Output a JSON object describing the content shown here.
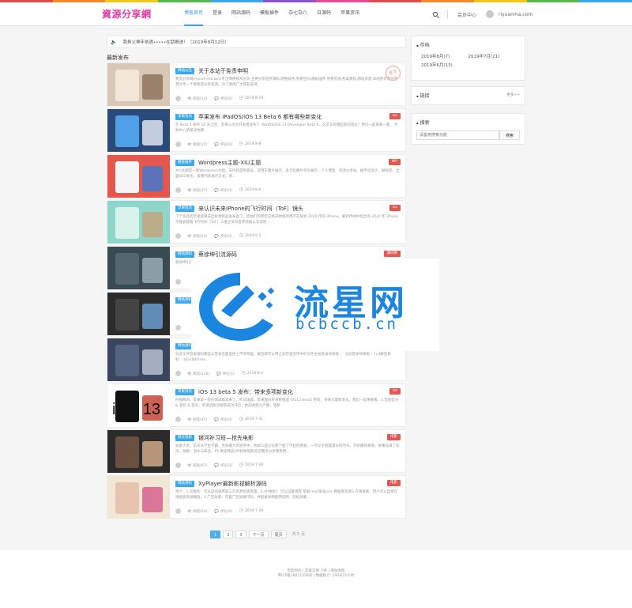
{
  "site": {
    "logo": "資源分享網",
    "logo_color": "#e03aa5",
    "accent": "#3a9df0"
  },
  "stripe_colors": [
    "#e24b4b",
    "#f08c2c",
    "#f2c81d",
    "#58b84d",
    "#39a8e8",
    "#8a56d0",
    "#e24b9a",
    "#e24b4b",
    "#f08c2c",
    "#f2c81d",
    "#58b84d",
    "#39a8e8"
  ],
  "nav": [
    "博客首页",
    "登录",
    "网站源码",
    "模板插件",
    "杂七杂八",
    "日源码",
    "苹果资讯"
  ],
  "header_right": {
    "user_center": "会员中心",
    "domain": "riyuanma.com"
  },
  "notice": {
    "icon": "speaker-icon",
    "text": "我希父神年依遇•••••在助推进！（2019年8月12日）"
  },
  "section_title": "最新发布",
  "posts": [
    {
      "cat": "网站公告",
      "title": "关于本站于免责申明",
      "tag": "",
      "stamp": "置顶",
      "excerpt": "我资分享网(riyuan-ma.bez)专注网络技术分享,主要分享程序源码,网络技术,免费空间,模板插件,免费资源,各类教程,网站资源,本站所有原创专营分享一个我希望分享资源。为了期待广大网友支持。",
      "views": "阅读(12)",
      "comments": "评论(0)",
      "date": "2019-8-10"
    },
    {
      "cat": "苹果资讯",
      "title": "苹果发布 iPadOS/iOS 13 Beta 6 都有哪些新变化",
      "tag": "ios",
      "stamp": "",
      "excerpt": "在 Beta 5 发布 10 天之后，苹果公司也开发者发布了 iPadOS/iOS 13 Developer Beta 6。这次又有哪些新的变化？我们一起来看一看。 控制中心新增深色模...",
      "views": "阅读(37)",
      "comments": "评论(0)",
      "date": "2019-8-8"
    },
    {
      "cat": "模板插件",
      "title": "Wordpress主题-XIU主题",
      "tag": "WP",
      "stamp": "",
      "excerpt": "XIU主题是一款Wordpress主题。支持百度熊掌号，适用于图片展示、多元化图片单页展示、个人博客、资源分享站、推平化设计，微商风、全面SEO优化、多重列表展示方式，新...",
      "views": "阅读(27)",
      "comments": "评论(0)",
      "date": "2019-8-6"
    },
    {
      "cat": "苹果资讯",
      "title": "来认识未来iPhone的飞行时间（ToF）镜头",
      "tag": "ios",
      "stamp": "",
      "excerpt": "下个多月后苹果就要开启秋季新品发布会了。而他们的明年已经开始保持用不在规划 2020 年的 iPhone。最新传闻中指出的 2020 年 iPhone 可能会配备飞行时间（ToF）三维立体深度传感器以实现更...",
      "views": "阅读(53)",
      "comments": "评论(0)",
      "date": "2019-8-2"
    },
    {
      "cat": "网站源码",
      "title": "蔡徐坤引流源码",
      "tag": "源码网",
      "stamp": "",
      "excerpt": "蔡徐坤引流源码，…",
      "views": "",
      "comments": "",
      "date": ""
    },
    {
      "cat": "网站源码",
      "title": "",
      "tag": "",
      "stamp": "",
      "excerpt": "",
      "views": "",
      "comments": "",
      "date": ""
    },
    {
      "cat": "网站源码",
      "title": "",
      "tag": "",
      "stamp": "",
      "excerpt": "包含文件登录源码那些以登录页面直接上传项目里，解压即可以用之前检查没用中的文件主站登录效果图 ： 注验登录效果图 ：[vi]解压目标：:ly[vi]bt/links...",
      "views": "阅读(116)",
      "comments": "评论(1)",
      "date": "2019-8-2"
    },
    {
      "cat": "苹果资讯",
      "title": "iOS 13 beta 5 发布：带来多项新变化",
      "tag": "ios",
      "stamp": "",
      "excerpt": "时隔两周，苹果第一轮的测试版又来了，昨日凌晨，苹果面向开发者推送 iOS13 beta5 更新，带来大量新变化。我们一起来看看。1.音频音乐 & 查热 & 音乐：新调试能活解密成功开启，依旧共能力严重，等新...",
      "views": "阅读(47)",
      "comments": "评论(0)",
      "date": "2019-7-31"
    },
    {
      "cat": "惊光电影",
      "title": "银河补习班—抢先电影",
      "tag": "电影",
      "stamp": "",
      "excerpt": "准备大宗，航天员学生学霸，生命最大的逆势中，他却以超过已那个能了不起的爸爸。一对父子跨越漫长的时光，守护最纯真情，故事充满了欢乐、温暖、泪水与奇迹。PS:更多精品VIP抢鲜电影欢迎我资分享网免费...",
      "views": "阅读(87)",
      "comments": "评论(0)",
      "date": "2019-7-29"
    },
    {
      "cat": "网站源码",
      "title": "XyPlayer最新影视解析源码",
      "tag": "电影",
      "stamp": "",
      "excerpt": "简介：1.云解析：可以自动调用第三方资源优质资源。2.API解析：可以设置调用 苹果cms/海洋cms 数据库资源3.在线搜索：用户可以直接在线搜索资源播放。4.广告屏蔽：内置广告屏蔽代码，并配备详细使用说明，轻松屏蔽...",
      "views": "阅读(63)",
      "comments": "评论(0)",
      "date": "2019-7-29"
    }
  ],
  "pager": {
    "pages": [
      "1",
      "2",
      "3"
    ],
    "next": "下一页",
    "last": "尾页",
    "total": "共 5 页"
  },
  "sidebar": {
    "archive_title": "存档",
    "archive": [
      "2019年8月(7)",
      "2019年7月(21)",
      "2019年6月(13)"
    ],
    "links_title": "链接",
    "links_more": "更多>>",
    "search_title": "搜索",
    "search_placeholder": "请善用搜索功能",
    "search_button": "搜索"
  },
  "footer": {
    "line1": "百度地标 | 友链交换: 0条 | 网站地图",
    "line2": "粤ICP备18011358号 | 数据统计: 190天21小时"
  },
  "watermark": {
    "cn": "流星网",
    "en": "bcbccb.cn"
  }
}
